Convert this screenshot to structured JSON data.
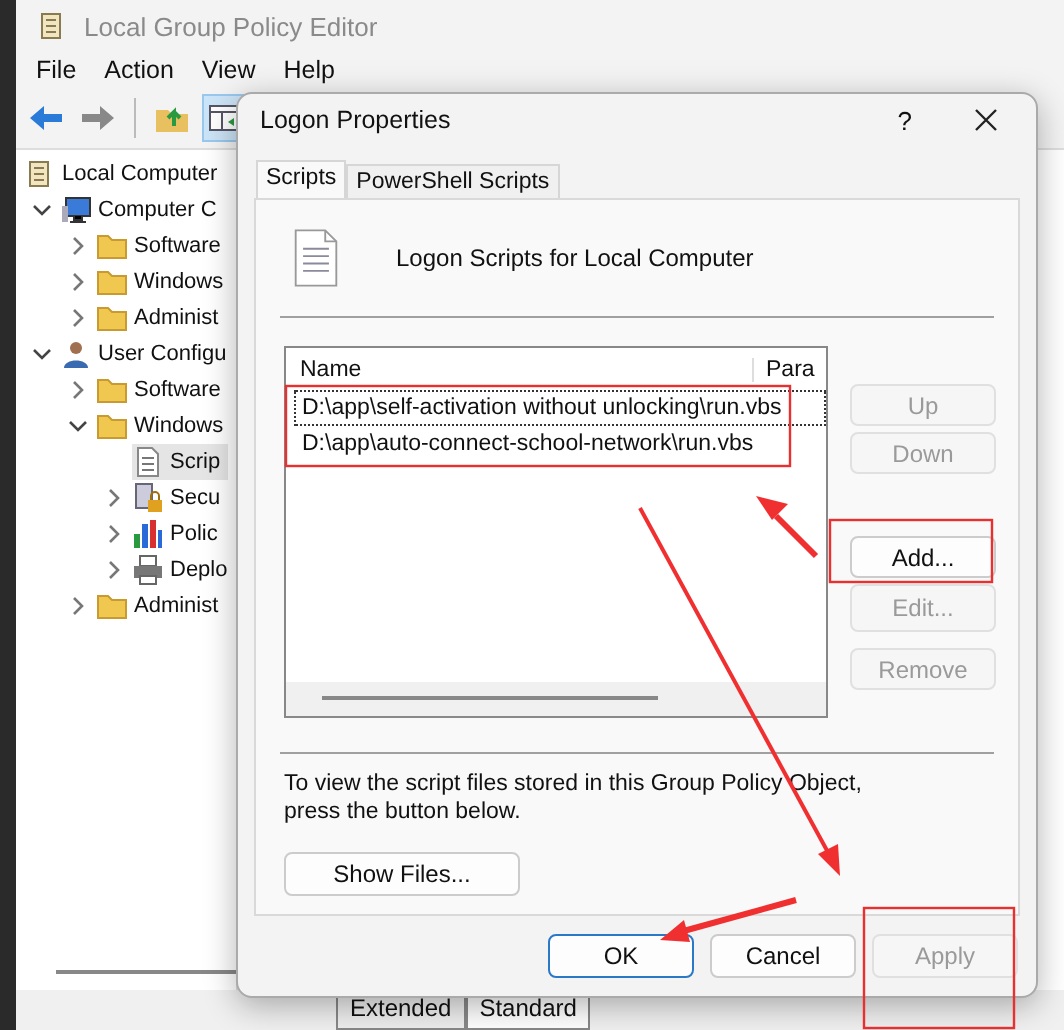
{
  "editor": {
    "title": "Local Group Policy Editor",
    "menu": [
      "File",
      "Action",
      "View",
      "Help"
    ],
    "tree": [
      {
        "label": "Local Computer",
        "kind": "policy",
        "selected": false,
        "children": [
          {
            "label": "Computer C",
            "kind": "computer",
            "selected": false,
            "expanded": true,
            "children": [
              {
                "label": "Software",
                "kind": "folder",
                "selected": false,
                "expanded": false
              },
              {
                "label": "Windows",
                "kind": "folder",
                "selected": false,
                "expanded": false
              },
              {
                "label": "Administ",
                "kind": "folder",
                "selected": false,
                "expanded": false
              }
            ]
          },
          {
            "label": "User Configu",
            "kind": "user",
            "selected": false,
            "expanded": true,
            "children": [
              {
                "label": "Software",
                "kind": "folder",
                "selected": false,
                "expanded": false
              },
              {
                "label": "Windows",
                "kind": "folder",
                "selected": false,
                "expanded": true,
                "children": [
                  {
                    "label": "Scrip",
                    "kind": "script",
                    "selected": true
                  },
                  {
                    "label": "Secu",
                    "kind": "security",
                    "selected": false,
                    "expanded": false
                  },
                  {
                    "label": "Polic",
                    "kind": "chart",
                    "selected": false,
                    "expanded": false
                  },
                  {
                    "label": "Deplo",
                    "kind": "printer",
                    "selected": false,
                    "expanded": false
                  }
                ]
              },
              {
                "label": "Administ",
                "kind": "folder",
                "selected": false,
                "expanded": false
              }
            ]
          }
        ]
      }
    ],
    "bottom_tabs": [
      {
        "label": "Extended",
        "selected": false
      },
      {
        "label": "Standard",
        "selected": true
      }
    ]
  },
  "dialog": {
    "title": "Logon Properties",
    "help": "?",
    "tabs": [
      {
        "label": "Scripts",
        "selected": true
      },
      {
        "label": "PowerShell Scripts",
        "selected": false
      }
    ],
    "heading": "Logon Scripts for Local Computer",
    "columns": [
      "Name",
      "Para"
    ],
    "rows": [
      {
        "name": "D:\\app\\self-activation without unlocking\\run.vbs",
        "focused": true
      },
      {
        "name": "D:\\app\\auto-connect-school-network\\run.vbs",
        "focused": false
      }
    ],
    "side_buttons": [
      {
        "label": "Up",
        "disabled": true
      },
      {
        "label": "Down",
        "disabled": true
      },
      {
        "label": "Add...",
        "disabled": false
      },
      {
        "label": "Edit...",
        "disabled": true
      },
      {
        "label": "Remove",
        "disabled": true
      }
    ],
    "note": "To view the script files stored in this Group Policy Object, press the button below.",
    "show_files": "Show Files...",
    "footer_buttons": [
      {
        "label": "OK",
        "disabled": false,
        "default": true
      },
      {
        "label": "Cancel",
        "disabled": false,
        "default": false
      },
      {
        "label": "Apply",
        "disabled": true,
        "default": false
      }
    ]
  }
}
